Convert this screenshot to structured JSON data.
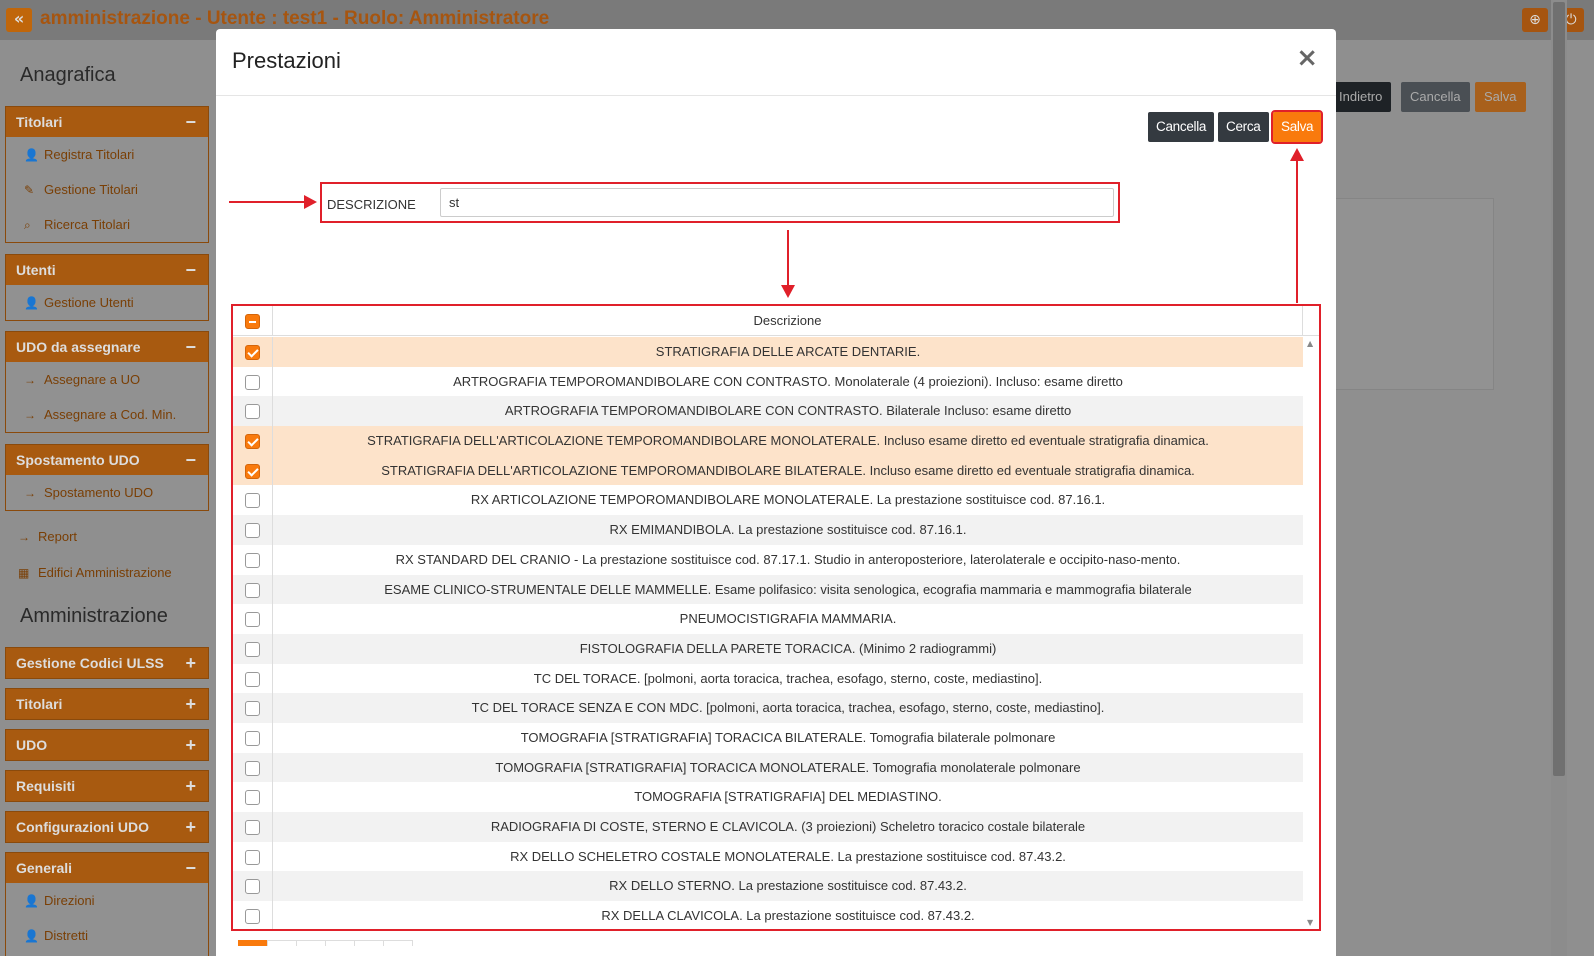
{
  "app": {
    "title": "amministrazione - Utente : test1 - Ruolo: Amministratore",
    "back_icon": "«",
    "globe_icon": "globe-icon",
    "power_icon": "power-icon"
  },
  "sidebar": {
    "section_anagrafica": "Anagrafica",
    "section_amministrazione": "Amministrazione",
    "panels": [
      {
        "title": "Titolari",
        "toggle": "−",
        "items": [
          "Registra Titolari",
          "Gestione Titolari",
          "Ricerca Titolari"
        ]
      },
      {
        "title": "Utenti",
        "toggle": "−",
        "items": [
          "Gestione Utenti"
        ]
      },
      {
        "title": "UDO da assegnare",
        "toggle": "−",
        "items": [
          "Assegnare a UO",
          "Assegnare a Cod. Min."
        ]
      },
      {
        "title": "Spostamento UDO",
        "toggle": "−",
        "items": [
          "Spostamento UDO"
        ]
      }
    ],
    "loose_items": [
      "Report",
      "Edifici Amministrazione"
    ],
    "admin_panels": [
      {
        "title": "Gestione Codici ULSS",
        "toggle": "+"
      },
      {
        "title": "Titolari",
        "toggle": "+"
      },
      {
        "title": "UDO",
        "toggle": "+"
      },
      {
        "title": "Requisiti",
        "toggle": "+"
      },
      {
        "title": "Configurazioni UDO",
        "toggle": "+"
      },
      {
        "title": "Generali",
        "toggle": "−",
        "items": [
          "Direzioni",
          "Distretti"
        ]
      }
    ]
  },
  "background_buttons": {
    "indietro": "Indietro",
    "cancella": "Cancella",
    "salva": "Salva"
  },
  "modal": {
    "title": "Prestazioni",
    "close": "×",
    "buttons": {
      "cancella": "Cancella",
      "cerca": "Cerca",
      "salva": "Salva"
    },
    "filter": {
      "label": "DESCRIZIONE",
      "value": "st"
    },
    "grid": {
      "column_header": "Descrizione",
      "rows": [
        {
          "desc": "STRATIGRAFIA DELLE ARCATE DENTARIE.",
          "checked": true
        },
        {
          "desc": "ARTROGRAFIA TEMPOROMANDIBOLARE CON CONTRASTO. Monolaterale (4 proiezioni). Incluso: esame diretto",
          "checked": false
        },
        {
          "desc": "ARTROGRAFIA TEMPOROMANDIBOLARE CON CONTRASTO. Bilaterale Incluso: esame diretto",
          "checked": false
        },
        {
          "desc": "STRATIGRAFIA DELL'ARTICOLAZIONE TEMPOROMANDIBOLARE MONOLATERALE. Incluso esame diretto ed eventuale stratigrafia dinamica.",
          "checked": true
        },
        {
          "desc": "STRATIGRAFIA DELL'ARTICOLAZIONE TEMPOROMANDIBOLARE BILATERALE. Incluso esame diretto ed eventuale stratigrafia dinamica.",
          "checked": true
        },
        {
          "desc": "RX ARTICOLAZIONE TEMPOROMANDIBOLARE MONOLATERALE. La prestazione sostituisce cod. 87.16.1.",
          "checked": false
        },
        {
          "desc": "RX EMIMANDIBOLA. La prestazione sostituisce cod. 87.16.1.",
          "checked": false
        },
        {
          "desc": "RX STANDARD DEL CRANIO - La prestazione sostituisce cod. 87.17.1. Studio in anteroposteriore, laterolaterale e occipito-naso-mento.",
          "checked": false
        },
        {
          "desc": "ESAME CLINICO-STRUMENTALE DELLE MAMMELLE. Esame polifasico: visita senologica, ecografia mammaria e mammografia bilaterale",
          "checked": false
        },
        {
          "desc": "PNEUMOCISTIGRAFIA MAMMARIA.",
          "checked": false
        },
        {
          "desc": "FISTOLOGRAFIA DELLA PARETE TORACICA. (Minimo 2 radiogrammi)",
          "checked": false
        },
        {
          "desc": "TC DEL TORACE. [polmoni, aorta toracica, trachea, esofago, sterno, coste, mediastino].",
          "checked": false
        },
        {
          "desc": "TC DEL TORACE SENZA E CON MDC. [polmoni, aorta toracica, trachea, esofago, sterno, coste, mediastino].",
          "checked": false
        },
        {
          "desc": "TOMOGRAFIA [STRATIGRAFIA] TORACICA BILATERALE. Tomografia bilaterale polmonare",
          "checked": false
        },
        {
          "desc": "TOMOGRAFIA [STRATIGRAFIA] TORACICA MONOLATERALE. Tomografia monolaterale polmonare",
          "checked": false
        },
        {
          "desc": "TOMOGRAFIA [STRATIGRAFIA] DEL MEDIASTINO.",
          "checked": false
        },
        {
          "desc": "RADIOGRAFIA DI COSTE, STERNO E CLAVICOLA. (3 proiezioni) Scheletro toracico costale bilaterale",
          "checked": false
        },
        {
          "desc": "RX DELLO SCHELETRO COSTALE MONOLATERALE. La prestazione sostituisce cod. 87.43.2.",
          "checked": false
        },
        {
          "desc": "RX DELLO STERNO. La prestazione sostituisce cod. 87.43.2.",
          "checked": false
        },
        {
          "desc": "RX DELLA CLAVICOLA. La prestazione sostituisce cod. 87.43.2.",
          "checked": false
        }
      ]
    }
  },
  "colors": {
    "accent": "#f97a0d",
    "highlight": "#e0202a",
    "selected_row": "#fde3ca"
  }
}
